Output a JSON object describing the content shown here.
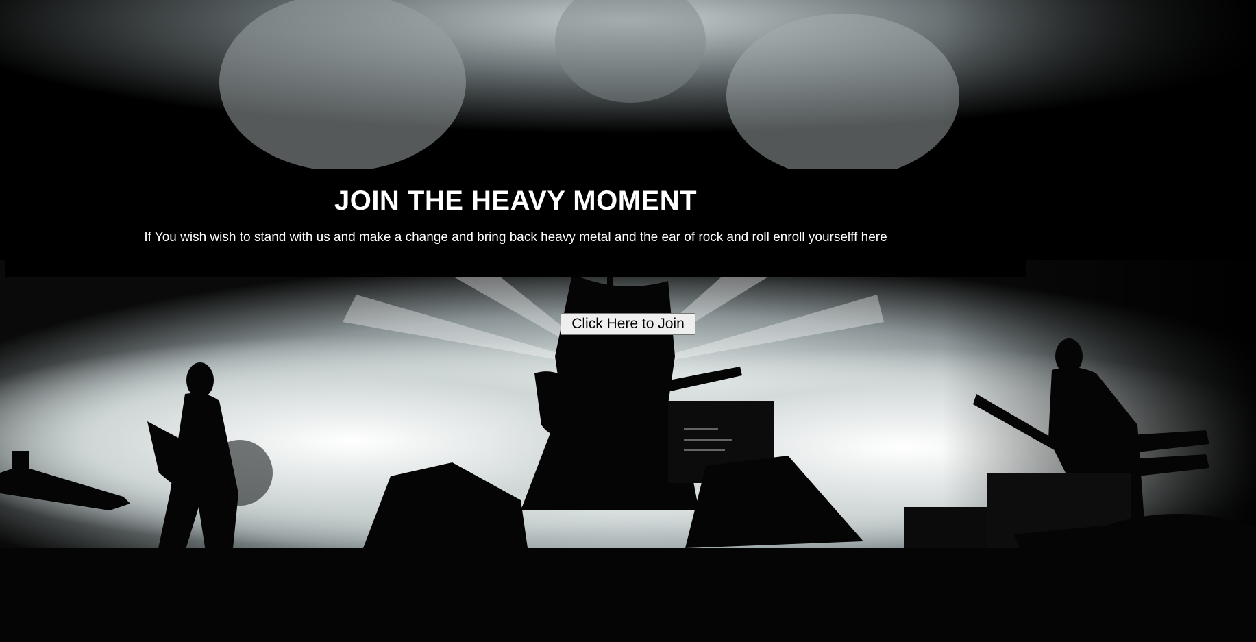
{
  "hero": {
    "title": "JOIN THE HEAVY MOMENT",
    "subtitle": "If You wish wish to stand with us and make a change and bring back heavy metal and the ear of rock and roll enroll yourselff here"
  },
  "cta": {
    "join_label": "Click Here to Join"
  },
  "background": {
    "icon": "concert-stage-photo",
    "colors": {
      "dark": "#000000",
      "light": "#f2f4f4"
    }
  }
}
